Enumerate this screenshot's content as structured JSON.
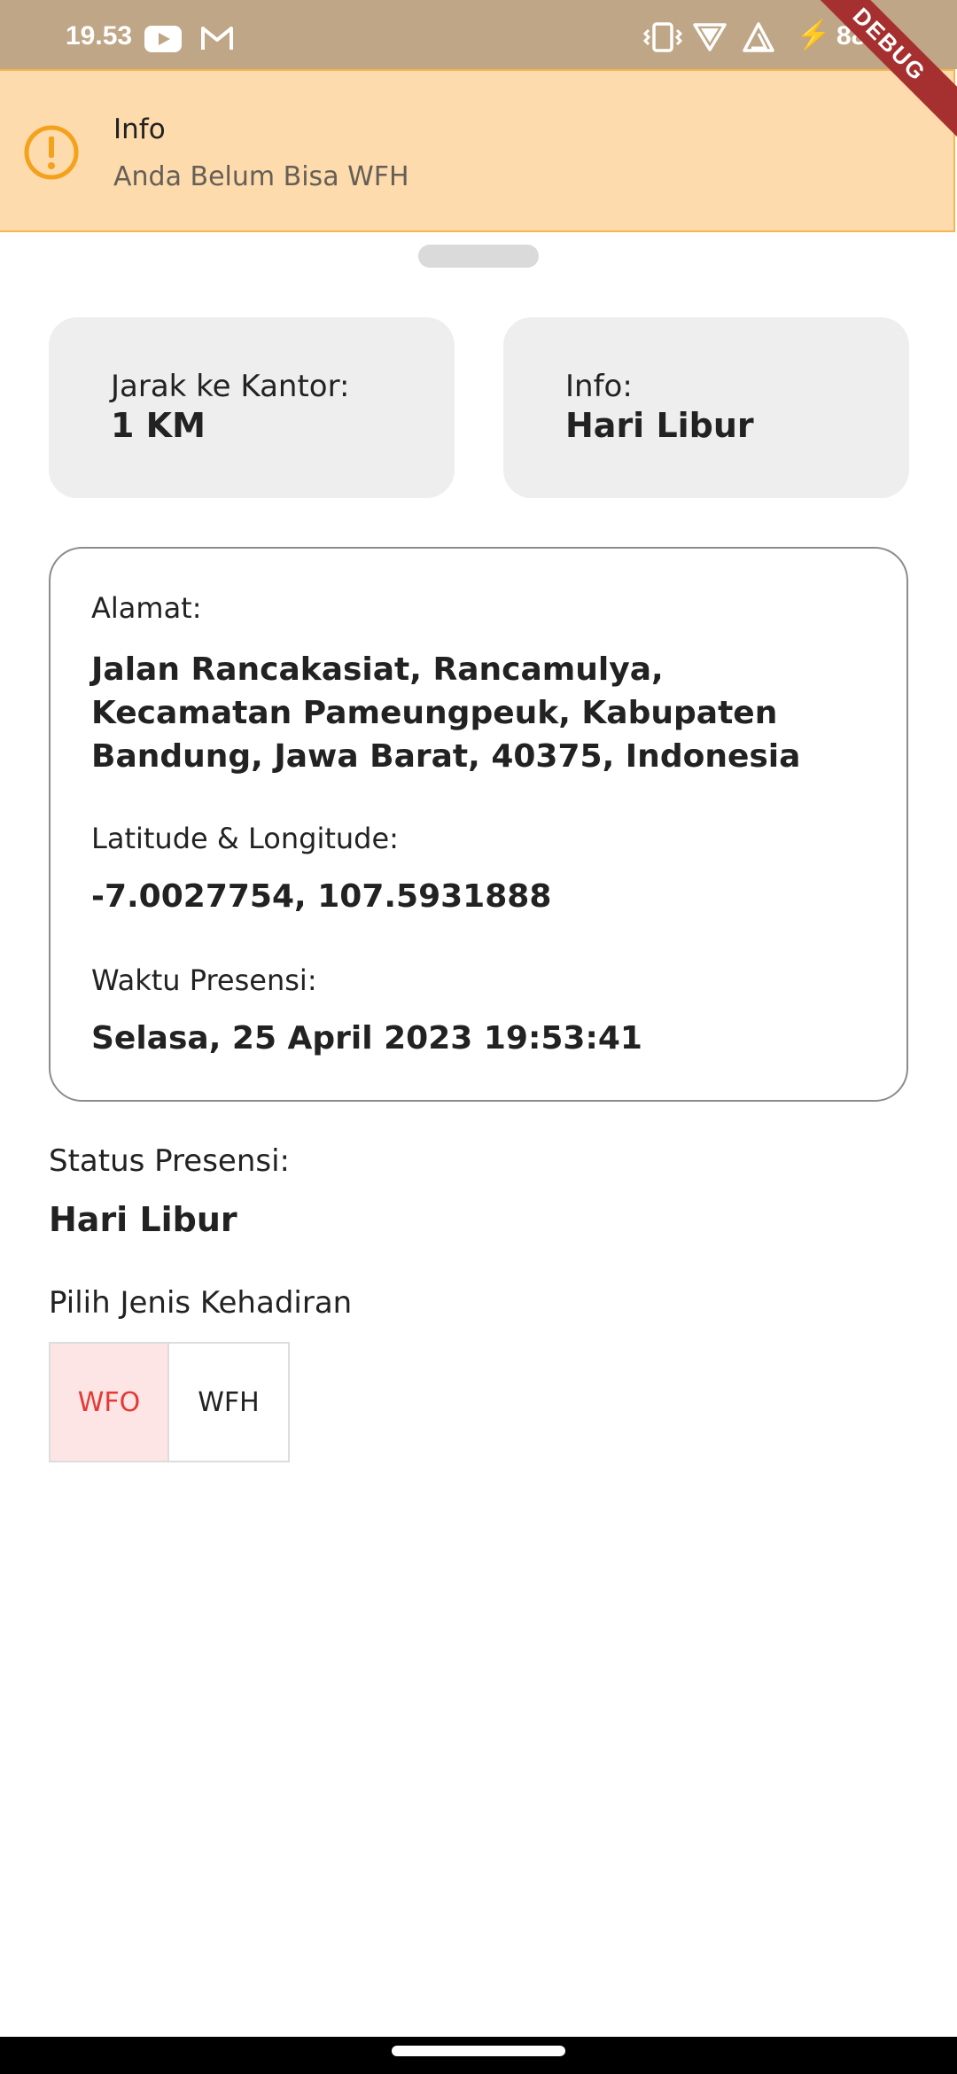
{
  "status_bar": {
    "time": "19.53",
    "battery": "88%",
    "icons": [
      "youtube-icon",
      "gmail-icon",
      "vibrate-icon",
      "wifi-icon",
      "signal-icon",
      "charging-icon"
    ]
  },
  "debug_banner": "DEBUG",
  "info_banner": {
    "title": "Info",
    "message": "Anda Belum Bisa WFH",
    "icon": "warning-icon",
    "colors": {
      "background": "#fddbac",
      "border": "#f4b64d",
      "icon": "#f4a21c"
    }
  },
  "cards": {
    "distance": {
      "label": "Jarak ke Kantor:",
      "value": "1 KM"
    },
    "info": {
      "label": "Info:",
      "value": "Hari Libur"
    }
  },
  "details": {
    "address_label": "Alamat:",
    "address_value": "Jalan Rancakasiat, Rancamulya, Kecamatan Pameungpeuk, Kabupaten Bandung, Jawa Barat, 40375, Indonesia",
    "coords_label": "Latitude & Longitude:",
    "coords_value": "-7.0027754, 107.5931888",
    "time_label": "Waktu Presensi:",
    "time_value": "Selasa, 25 April 2023 19:53:41"
  },
  "status": {
    "label": "Status Presensi:",
    "value": "Hari Libur"
  },
  "attendance": {
    "label": "Pilih Jenis Kehadiran",
    "options": [
      {
        "label": "WFO",
        "selected": true
      },
      {
        "label": "WFH",
        "selected": false
      }
    ],
    "colors": {
      "selected_bg": "#fde5e5",
      "selected_text": "#e53935"
    }
  }
}
